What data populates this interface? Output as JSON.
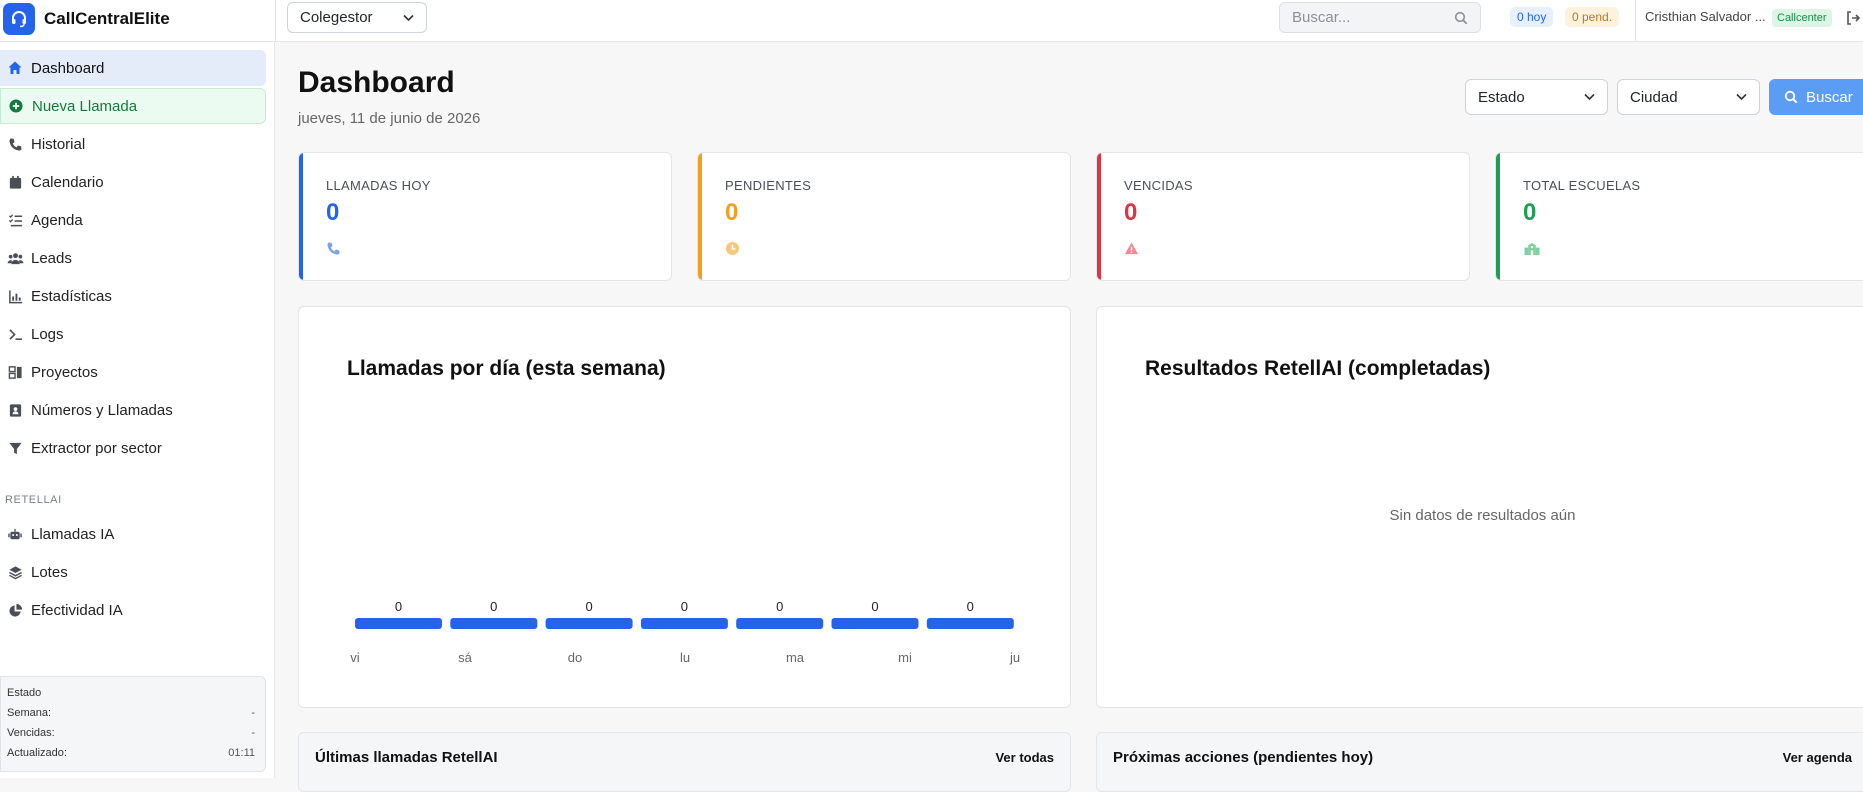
{
  "app": {
    "title": "CallCentralElite"
  },
  "topbar": {
    "company_selected": "Colegestor",
    "search_placeholder": "Buscar...",
    "today_count": "0 hoy",
    "pending_count": "0 pend.",
    "user_name": "Cristhian Salvador ...",
    "user_role": "Callcenter"
  },
  "sidebar": {
    "items": [
      {
        "label": "Dashboard",
        "icon": "home-icon"
      },
      {
        "label": "Nueva Llamada",
        "icon": "plus-circle-icon"
      },
      {
        "label": "Historial",
        "icon": "phone-icon"
      },
      {
        "label": "Calendario",
        "icon": "calendar-icon"
      },
      {
        "label": "Agenda",
        "icon": "list-check-icon"
      },
      {
        "label": "Leads",
        "icon": "users-icon"
      },
      {
        "label": "Estadísticas",
        "icon": "chart-icon"
      },
      {
        "label": "Logs",
        "icon": "terminal-icon"
      },
      {
        "label": "Proyectos",
        "icon": "project-icon"
      },
      {
        "label": "Números y Llamadas",
        "icon": "contact-icon"
      },
      {
        "label": "Extractor por sector",
        "icon": "filter-icon"
      }
    ],
    "section_label": "RETELLAI",
    "ai_items": [
      {
        "label": "Llamadas IA",
        "icon": "robot-icon"
      },
      {
        "label": "Lotes",
        "icon": "layers-icon"
      },
      {
        "label": "Efectividad IA",
        "icon": "pie-icon"
      }
    ],
    "status": {
      "title": "Estado",
      "rows": [
        {
          "label": "Semana:",
          "value": "-"
        },
        {
          "label": "Vencidas:",
          "value": "-"
        },
        {
          "label": "Actualizado:",
          "value": "01:11"
        }
      ]
    }
  },
  "main": {
    "title": "Dashboard",
    "date": "jueves, 11 de junio de 2026",
    "filters": {
      "estado": "Estado",
      "ciudad": "Ciudad",
      "buscar": "Buscar"
    },
    "kpis": [
      {
        "label": "LLAMADAS HOY",
        "value": "0",
        "color": "#2563eb",
        "icon": "phone-icon"
      },
      {
        "label": "PENDIENTES",
        "value": "0",
        "color": "#f0a020",
        "icon": "clock-icon"
      },
      {
        "label": "VENCIDAS",
        "value": "0",
        "color": "#dc3545",
        "icon": "warning-icon"
      },
      {
        "label": "TOTAL ESCUELAS",
        "value": "0",
        "color": "#1f9d55",
        "icon": "school-icon"
      }
    ],
    "calls_chart": {
      "title": "Llamadas por día (esta semana)"
    },
    "results_card": {
      "title": "Resultados RetellAI (completadas)",
      "empty": "Sin datos de resultados aún"
    },
    "recent_calls": {
      "title": "Últimas llamadas RetellAI",
      "link": "Ver todas"
    },
    "next_actions": {
      "title": "Próximas acciones (pendientes hoy)",
      "link": "Ver agenda"
    }
  },
  "chart_data": {
    "type": "bar",
    "title": "Llamadas por día (esta semana)",
    "categories": [
      "vi",
      "sá",
      "do",
      "lu",
      "ma",
      "mi",
      "ju"
    ],
    "values": [
      0,
      0,
      0,
      0,
      0,
      0,
      0
    ],
    "color": "#2563eb"
  }
}
